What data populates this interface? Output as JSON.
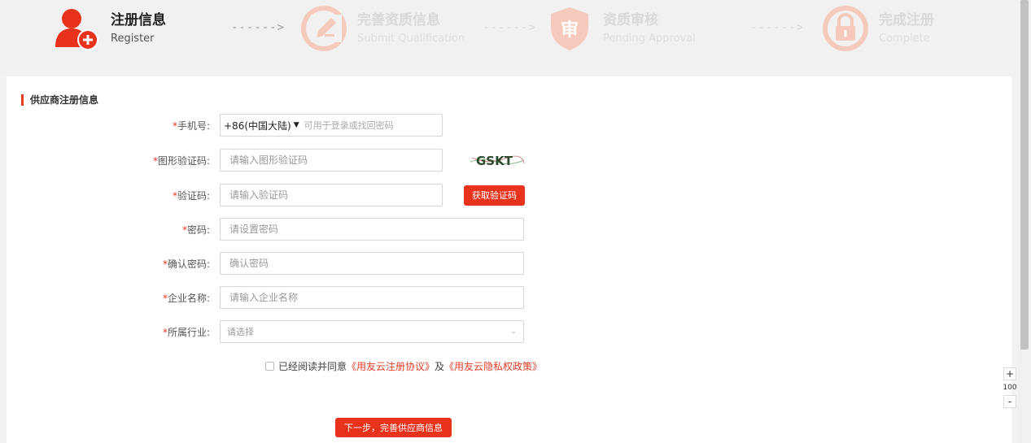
{
  "steps": [
    {
      "title": "注册信息",
      "subtitle": "Register",
      "icon": "user-plus-icon",
      "active": true
    },
    {
      "title": "完善资质信息",
      "subtitle": "Submit Qualification",
      "icon": "edit-icon",
      "active": false
    },
    {
      "title": "资质审核",
      "subtitle": "Pending Approval",
      "icon": "shield-review-icon",
      "active": false
    },
    {
      "title": "完成注册",
      "subtitle": "Complete",
      "icon": "lock-icon",
      "active": false
    }
  ],
  "arrow": "------>",
  "colors": {
    "accent": "#e8321c",
    "icon_active": "#e8321c",
    "icon_inactive": "#f6c9bd"
  },
  "form": {
    "section_title": "供应商注册信息",
    "required_mark": "*",
    "phone": {
      "label": "手机号:",
      "country_code": "+86(中国大陆)",
      "placeholder": "可用于登录或找回密码"
    },
    "captcha": {
      "label": "图形验证码:",
      "placeholder": "请输入图形验证码",
      "image_text": "GSKT"
    },
    "sms": {
      "label": "验证码:",
      "placeholder": "请输入验证码",
      "button": "获取验证码"
    },
    "password": {
      "label": "密码:",
      "placeholder": "请设置密码"
    },
    "confirm": {
      "label": "确认密码:",
      "placeholder": "确认密码"
    },
    "company": {
      "label": "企业名称:",
      "placeholder": "请输入企业名称"
    },
    "industry": {
      "label": "所属行业:",
      "placeholder": "请选择"
    },
    "agreement": {
      "text": "已经阅读并同意",
      "link1": "《用友云注册协议》",
      "and": "及",
      "link2": "《用友云隐私权政策》"
    },
    "next_button": "下一步，完善供应商信息"
  },
  "zoom": {
    "plus": "+",
    "value": "100",
    "minus": "-"
  }
}
